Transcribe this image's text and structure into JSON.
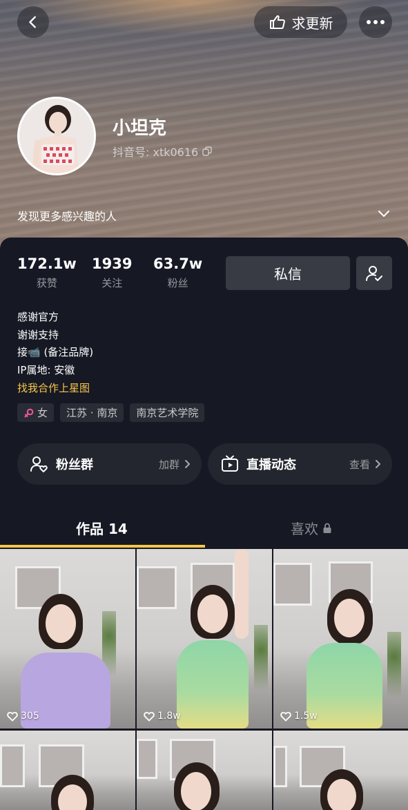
{
  "header": {
    "update_label": "求更新",
    "nickname": "小坦克",
    "douyin_id": "抖音号: xtk0616",
    "discover_label": "发现更多感兴趣的人"
  },
  "stats": [
    {
      "value": "172.1w",
      "label": "获赞"
    },
    {
      "value": "1939",
      "label": "关注"
    },
    {
      "value": "63.7w",
      "label": "粉丝"
    }
  ],
  "actions": {
    "message_label": "私信"
  },
  "bio": {
    "lines": [
      "感谢官方",
      "谢谢支持",
      "接📹 (备注品牌)",
      "IP属地: 安徽"
    ],
    "link": "找我合作上星图"
  },
  "tags": [
    "女",
    "江苏 · 南京",
    "南京艺术学院"
  ],
  "cards": [
    {
      "title": "粉丝群",
      "action": "加群"
    },
    {
      "title": "直播动态",
      "action": "查看"
    }
  ],
  "tabs": {
    "works": "作品 14",
    "likes": "喜欢"
  },
  "videos": [
    {
      "likes": "305"
    },
    {
      "likes": "1.8w"
    },
    {
      "likes": "1.5w"
    }
  ],
  "colors": {
    "accent": "#f7c64a",
    "background": "#161823",
    "button": "#393b44",
    "gender": "#f0569b"
  }
}
